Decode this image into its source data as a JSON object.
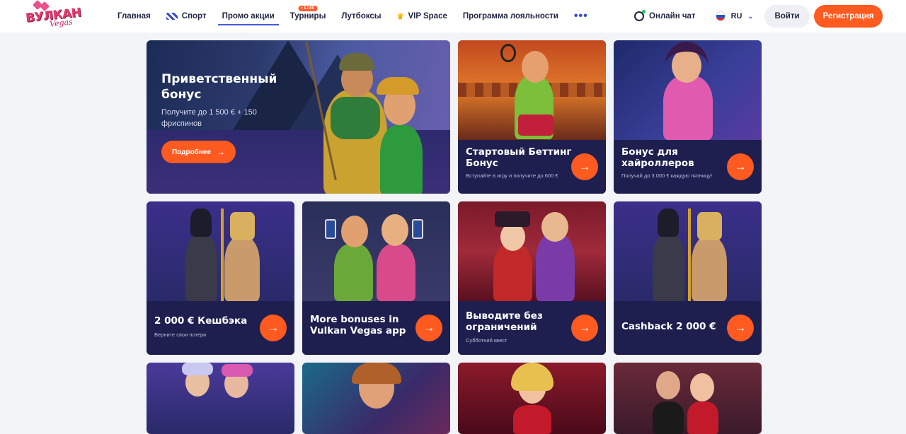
{
  "header": {
    "logo_text": "ВУЛКАН",
    "logo_sub": "Vegas",
    "nav": [
      {
        "label": "Главная",
        "icon": ""
      },
      {
        "label": "Спорт",
        "icon": "sport-icon"
      },
      {
        "label": "Промо акции",
        "icon": "",
        "active": true
      },
      {
        "label": "Турниры",
        "icon": "",
        "badge": "• LIVE"
      },
      {
        "label": "Лутбоксы",
        "icon": ""
      },
      {
        "label": "VIP Space",
        "icon": "crown-icon"
      },
      {
        "label": "Программа лояльности",
        "icon": ""
      }
    ],
    "more": "•••",
    "chat_label": "Онлайн чат",
    "lang": "RU",
    "login": "Войти",
    "register": "Регистрация"
  },
  "hero": {
    "title": "Приветственный бонус",
    "subtitle": "Получите до 1 500 € + 150 фриспинов",
    "button": "Подробнее",
    "arrow": "→"
  },
  "cards": [
    {
      "title": "Стартовый Беттинг Бонус",
      "subtitle": "Вступайте в игру и получите до 600 €",
      "art": "tennis-player"
    },
    {
      "title": "Бонус для хайроллеров",
      "subtitle": "Получай до 3 000 € каждую пятницу!",
      "art": "pink-woman"
    },
    {
      "title": "2 000 € Кешбэка",
      "subtitle": "Верните свои потери",
      "art": "egyptian-gods"
    },
    {
      "title": "More bonuses in Vulkan Vegas app",
      "subtitle": "",
      "art": "girls-with-phones"
    },
    {
      "title": "Выводите без ограничений",
      "subtitle": "Субботний квест",
      "art": "jesters"
    },
    {
      "title": "Cashback 2 000 €",
      "subtitle": "",
      "art": "egyptian-gods"
    }
  ],
  "arrow": "→",
  "colors": {
    "accent": "#ff5a1f",
    "card_bg": "#1e1f4f",
    "nav_active": "#4a5cd8"
  }
}
